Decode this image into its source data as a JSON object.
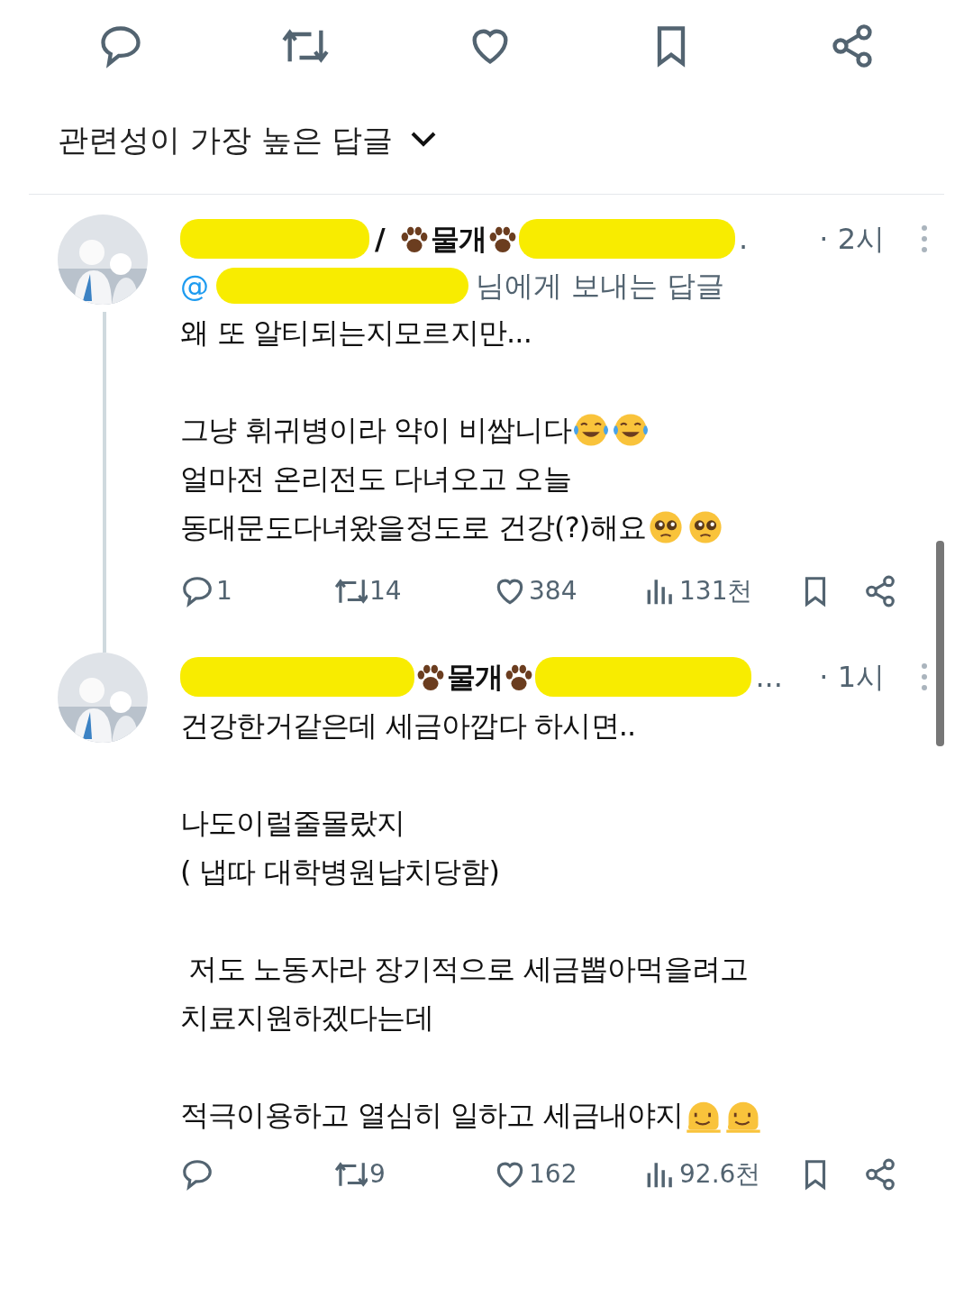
{
  "sort": {
    "label": "관련성이 가장 높은 답글"
  },
  "replies": [
    {
      "redacted": true,
      "name_prefix": "/",
      "name": "물개",
      "name_tail": ".",
      "time": "· 2시",
      "reply_to": {
        "at": "@",
        "text": "님에게 보내는 답글"
      },
      "paragraphs": [
        [
          {
            "text": "왜 또 알티되는지모르지만..."
          }
        ],
        [
          {
            "text": "그냥 휘귀병이라 약이 비쌉니다",
            "emojis": [
              {
                "kind": "tears-of-joy"
              },
              {
                "kind": "tears-of-joy"
              }
            ]
          },
          {
            "text": "얼마전 온리전도 다녀오고 오늘"
          },
          {
            "text": "동대문도다녀왔을정도로 건강(?)해요",
            "emojis": [
              {
                "kind": "pleading"
              },
              {
                "kind": "pleading"
              }
            ]
          }
        ]
      ],
      "actions": {
        "replies": "1",
        "reposts": "14",
        "likes": "384",
        "views": "131천"
      },
      "thread_continues": true
    },
    {
      "redacted": true,
      "name": "물개",
      "name_tail": "...",
      "time": "· 1시",
      "paragraphs": [
        [
          {
            "text": "건강한거같은데 세금아깝다 하시면.."
          }
        ],
        [
          {
            "text": "나도이럴줄몰랐지"
          },
          {
            "text": "( 냅따 대학병원납치당함)"
          }
        ],
        [
          {
            "text": " 저도 노동자라 장기적으로 세금뽑아먹을려고"
          },
          {
            "text": "치료지원하겠다는데"
          }
        ],
        [
          {
            "text": "적극이용하고 열심히 일하고 세금내야지",
            "emojis": [
              {
                "kind": "melting"
              },
              {
                "kind": "melting"
              }
            ]
          }
        ]
      ],
      "actions": {
        "reposts": "9",
        "likes": "162",
        "views": "92.6천"
      },
      "thread_continues": false
    }
  ]
}
